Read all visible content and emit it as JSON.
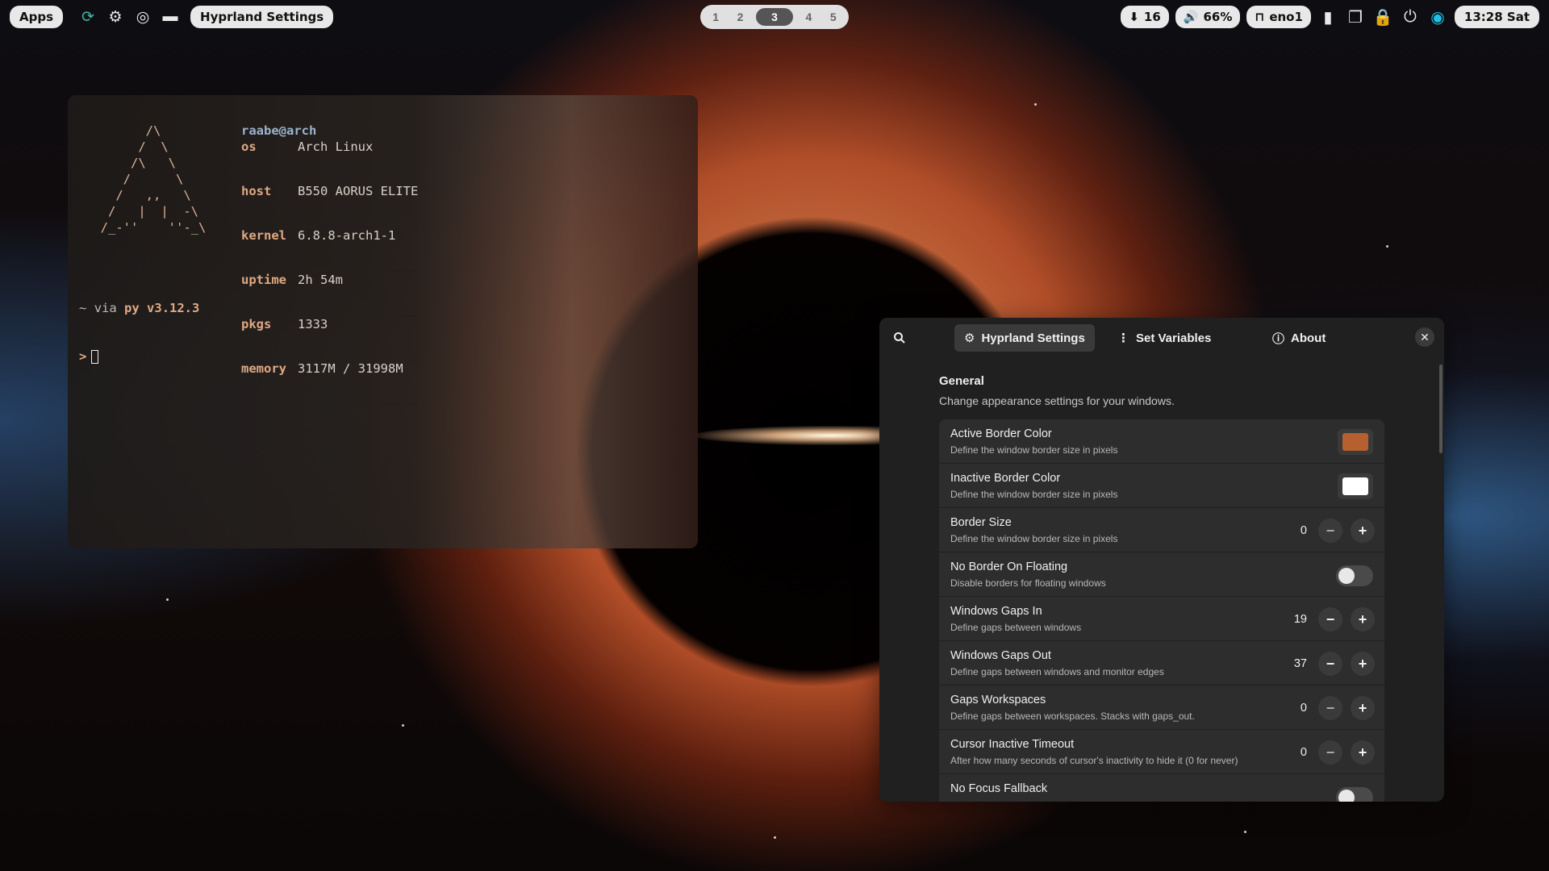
{
  "topbar": {
    "apps_label": "Apps",
    "active_window_title": "Hyprland Settings",
    "left_icons": [
      "refresh-icon",
      "gear-icon",
      "chrome-icon",
      "folder-icon"
    ],
    "workspaces": [
      "1",
      "2",
      "3",
      "4",
      "5"
    ],
    "active_workspace": "3",
    "updates": "16",
    "volume": "66%",
    "network": "eno1",
    "clock": "13:28 Sat"
  },
  "terminal": {
    "user": "raabe@arch",
    "fetch": [
      {
        "key": "os",
        "value": "Arch Linux"
      },
      {
        "key": "host",
        "value": "B550 AORUS ELITE"
      },
      {
        "key": "kernel",
        "value": "6.8.8-arch1-1"
      },
      {
        "key": "uptime",
        "value": "2h 54m"
      },
      {
        "key": "pkgs",
        "value": "1333"
      },
      {
        "key": "memory",
        "value": "3117M / 31998M"
      }
    ],
    "prompt_dir": "~",
    "prompt_via": "via",
    "prompt_py": "py v3.12.3",
    "prompt_caret": ">"
  },
  "settings": {
    "tabs": {
      "hyprland": "Hyprland Settings",
      "variables": "Set Variables",
      "about": "About"
    },
    "close": "✕",
    "section_title": "General",
    "section_desc": "Change appearance settings for your windows.",
    "colors": {
      "active_border": "#b5602e",
      "inactive_border": "#ffffff"
    },
    "rows": [
      {
        "title": "Active Border Color",
        "sub": "Define the window border size in pixels"
      },
      {
        "title": "Inactive Border Color",
        "sub": "Define the window border size in pixels"
      },
      {
        "title": "Border Size",
        "sub": "Define the window border size in pixels",
        "value": "0"
      },
      {
        "title": "No Border On Floating",
        "sub": "Disable borders for floating windows"
      },
      {
        "title": "Windows Gaps In",
        "sub": "Define gaps between windows",
        "value": "19"
      },
      {
        "title": "Windows Gaps Out",
        "sub": "Define gaps between windows and monitor edges",
        "value": "37"
      },
      {
        "title": "Gaps Workspaces",
        "sub": "Define gaps between workspaces. Stacks with gaps_out.",
        "value": "0"
      },
      {
        "title": "Cursor Inactive Timeout",
        "sub": "After how many seconds of cursor's inactivity to hide it (0 for never)",
        "value": "0"
      },
      {
        "title": "No Focus Fallback",
        "sub": ""
      }
    ]
  }
}
